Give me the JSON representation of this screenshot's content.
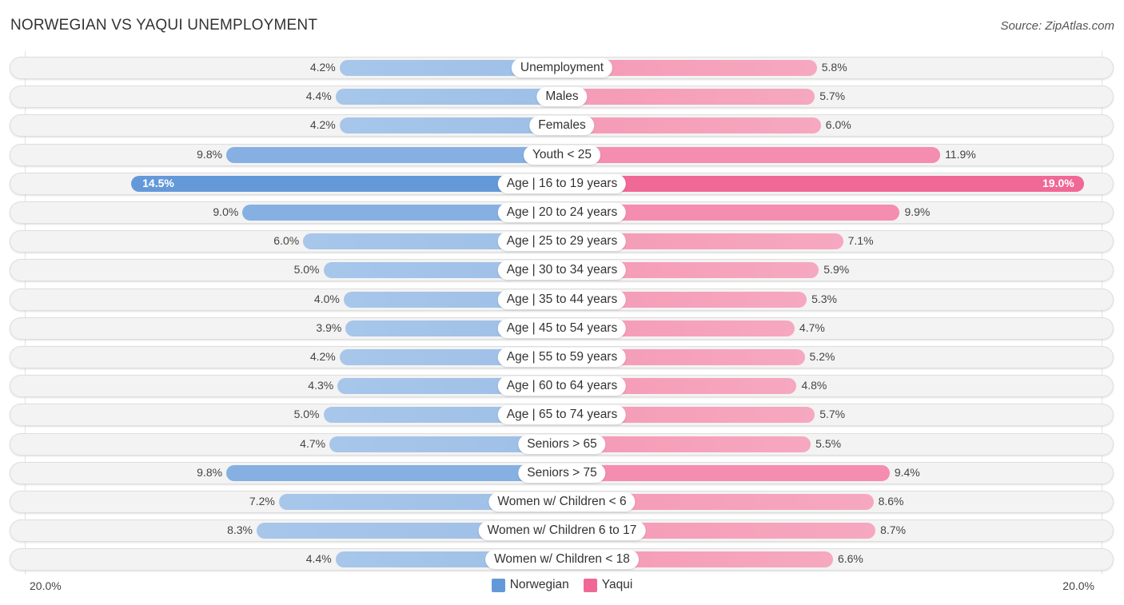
{
  "title": "NORWEGIAN VS YAQUI UNEMPLOYMENT",
  "source": "Source: ZipAtlas.com",
  "chart_data": {
    "type": "bar",
    "orientation": "horizontal-diverging",
    "title": "NORWEGIAN VS YAQUI UNEMPLOYMENT",
    "axis_min_label": "20.0%",
    "axis_max_label": "20.0%",
    "xlim": [
      0,
      20
    ],
    "legend_position": "bottom-center",
    "colors": {
      "Norwegian": "#6499d9",
      "Yaqui": "#f06895"
    },
    "categories": [
      "Unemployment",
      "Males",
      "Females",
      "Youth < 25",
      "Age | 16 to 19 years",
      "Age | 20 to 24 years",
      "Age | 25 to 29 years",
      "Age | 30 to 34 years",
      "Age | 35 to 44 years",
      "Age | 45 to 54 years",
      "Age | 55 to 59 years",
      "Age | 60 to 64 years",
      "Age | 65 to 74 years",
      "Seniors > 65",
      "Seniors > 75",
      "Women w/ Children < 6",
      "Women w/ Children 6 to 17",
      "Women w/ Children < 18"
    ],
    "series": [
      {
        "name": "Norwegian",
        "values": [
          4.2,
          4.4,
          4.2,
          9.8,
          14.5,
          9.0,
          6.0,
          5.0,
          4.0,
          3.9,
          4.2,
          4.3,
          5.0,
          4.7,
          9.8,
          7.2,
          8.3,
          4.4
        ]
      },
      {
        "name": "Yaqui",
        "values": [
          5.8,
          5.7,
          6.0,
          11.9,
          19.0,
          9.9,
          7.1,
          5.9,
          5.3,
          4.7,
          5.2,
          4.8,
          5.7,
          5.5,
          9.4,
          8.6,
          8.7,
          6.6
        ]
      }
    ],
    "value_labels": {
      "Norwegian": [
        "4.2%",
        "4.4%",
        "4.2%",
        "9.8%",
        "14.5%",
        "9.0%",
        "6.0%",
        "5.0%",
        "4.0%",
        "3.9%",
        "4.2%",
        "4.3%",
        "5.0%",
        "4.7%",
        "9.8%",
        "7.2%",
        "8.3%",
        "4.4%"
      ],
      "Yaqui": [
        "5.8%",
        "5.7%",
        "6.0%",
        "11.9%",
        "19.0%",
        "9.9%",
        "7.1%",
        "5.9%",
        "5.3%",
        "4.7%",
        "5.2%",
        "4.8%",
        "5.7%",
        "5.5%",
        "9.4%",
        "8.6%",
        "8.7%",
        "6.6%"
      ]
    }
  },
  "legend": [
    {
      "name": "Norwegian",
      "color": "#6499d9"
    },
    {
      "name": "Yaqui",
      "color": "#f06895"
    }
  ]
}
